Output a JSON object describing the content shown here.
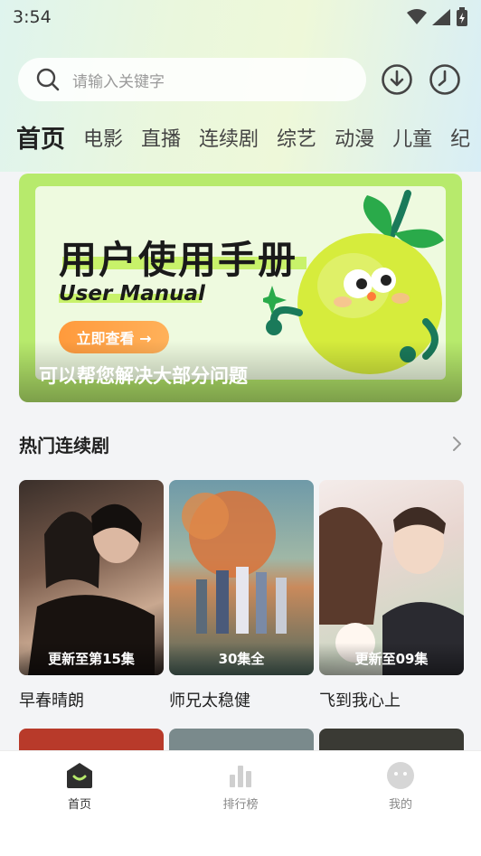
{
  "status": {
    "time": "3:54"
  },
  "search": {
    "placeholder": "请输入关键字"
  },
  "tabs": [
    "首页",
    "电影",
    "直播",
    "连续剧",
    "综艺",
    "动漫",
    "儿童",
    "纪"
  ],
  "banner": {
    "title": "用户使用手册",
    "subtitle": "User Manual",
    "button_label": "立即查看 →",
    "caption": "可以帮您解决大部分问题"
  },
  "section": {
    "title": "热门连续剧"
  },
  "cards": [
    {
      "title": "早春晴朗",
      "badge": "更新至第15集"
    },
    {
      "title": "师兄太稳健",
      "badge": "30集全"
    },
    {
      "title": "飞到我心上",
      "badge": "更新至09集"
    }
  ],
  "nav": [
    {
      "label": "首页"
    },
    {
      "label": "排行榜"
    },
    {
      "label": "我的"
    }
  ],
  "colors": {
    "accent": "#b7ea6c",
    "button": "#ff9a3c"
  }
}
